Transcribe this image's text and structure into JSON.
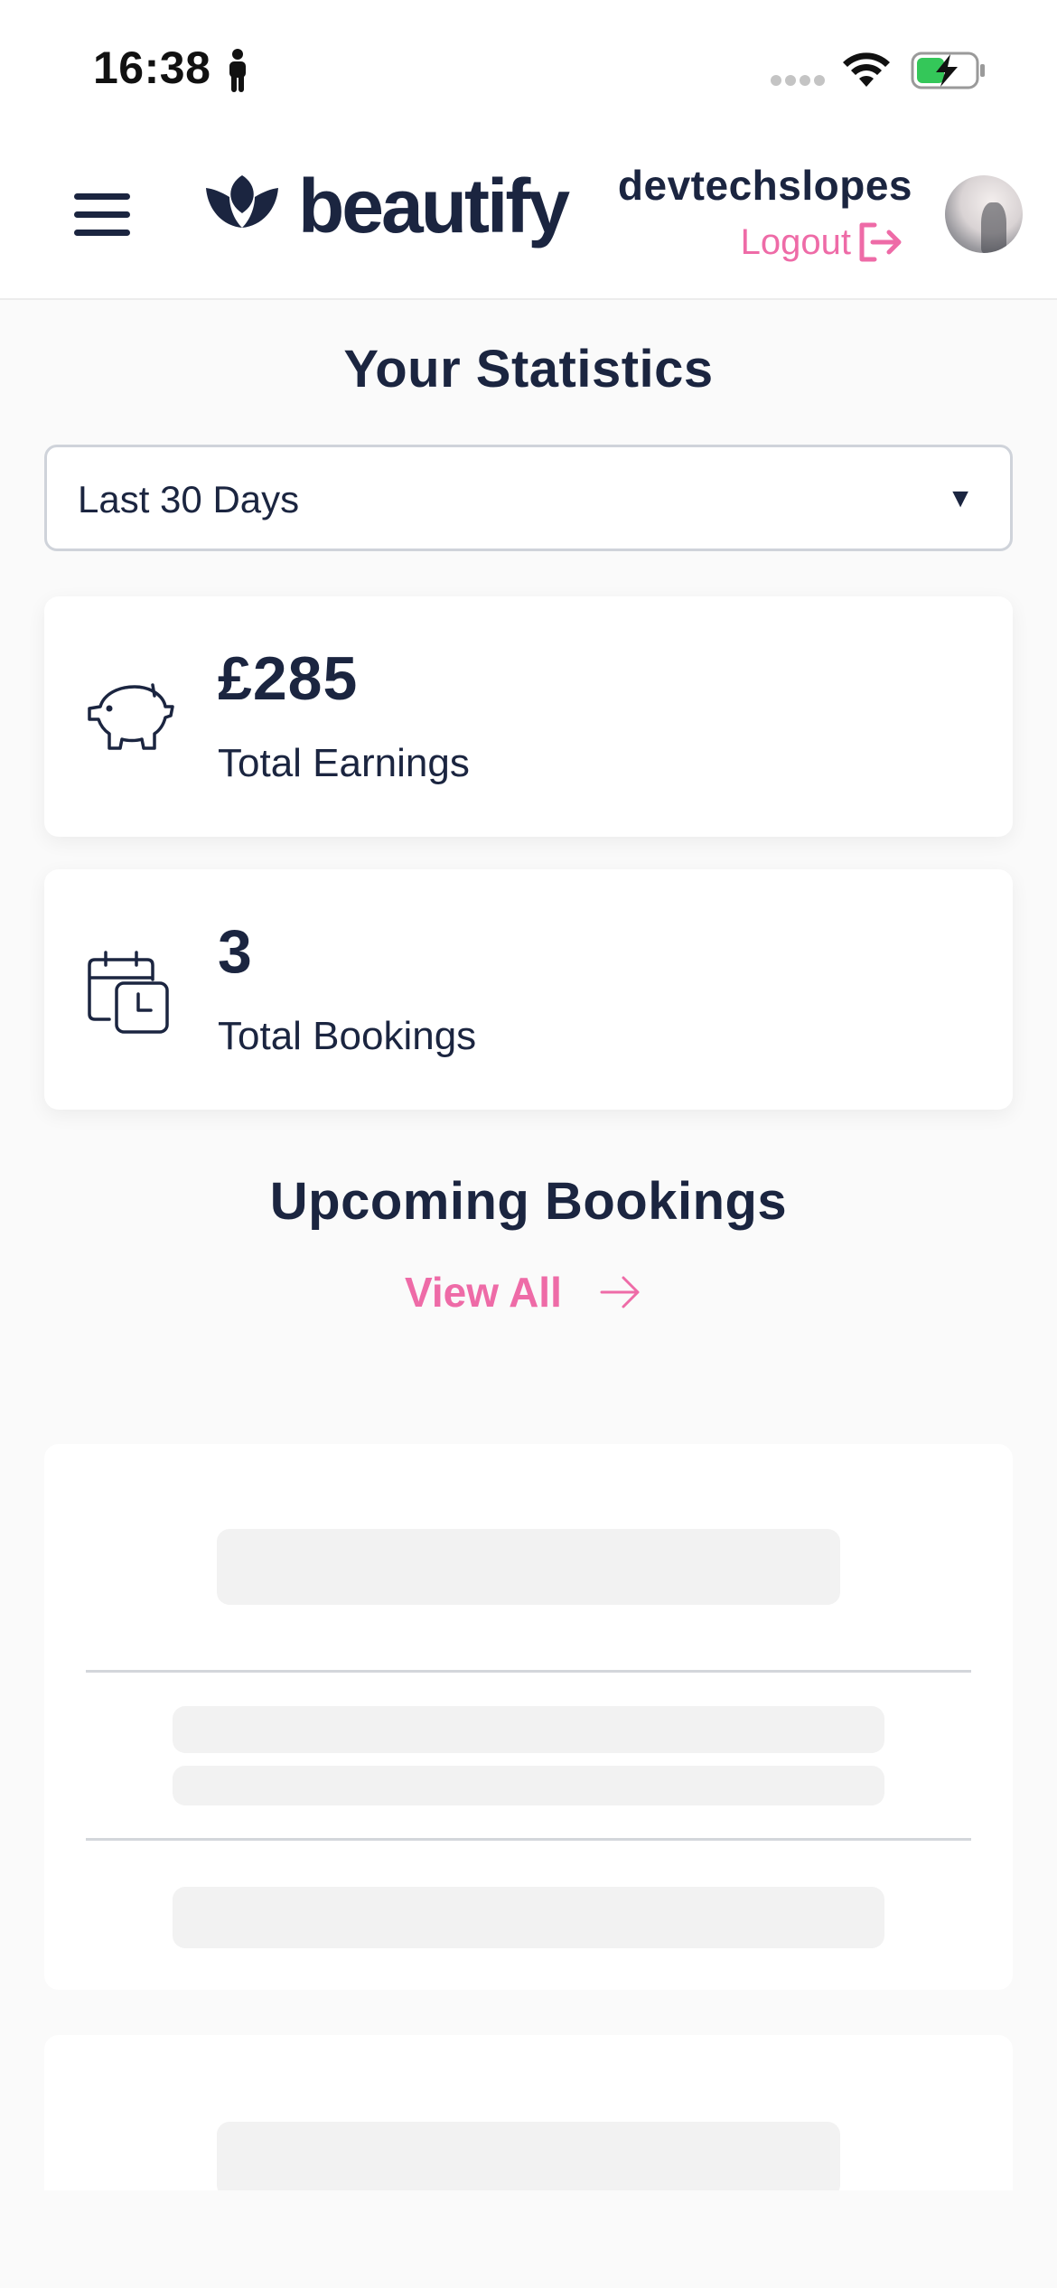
{
  "status_bar": {
    "time": "16:38",
    "icons": [
      "person-icon",
      "signal-icon",
      "wifi-icon",
      "battery-charging-icon"
    ],
    "battery_color": "#34c759"
  },
  "header": {
    "logo_text": "beautify",
    "username": "devtechslopes",
    "logout_label": "Logout",
    "accent_color": "#ee6ba7",
    "brand_color": "#1b2540"
  },
  "statistics": {
    "title": "Your Statistics",
    "range_selected": "Last 30 Days",
    "cards": [
      {
        "icon": "piggy-bank-icon",
        "value": "£285",
        "label": "Total Earnings"
      },
      {
        "icon": "calendar-clock-icon",
        "value": "3",
        "label": "Total Bookings"
      }
    ]
  },
  "upcoming": {
    "title": "Upcoming Bookings",
    "view_all_label": "View All"
  }
}
